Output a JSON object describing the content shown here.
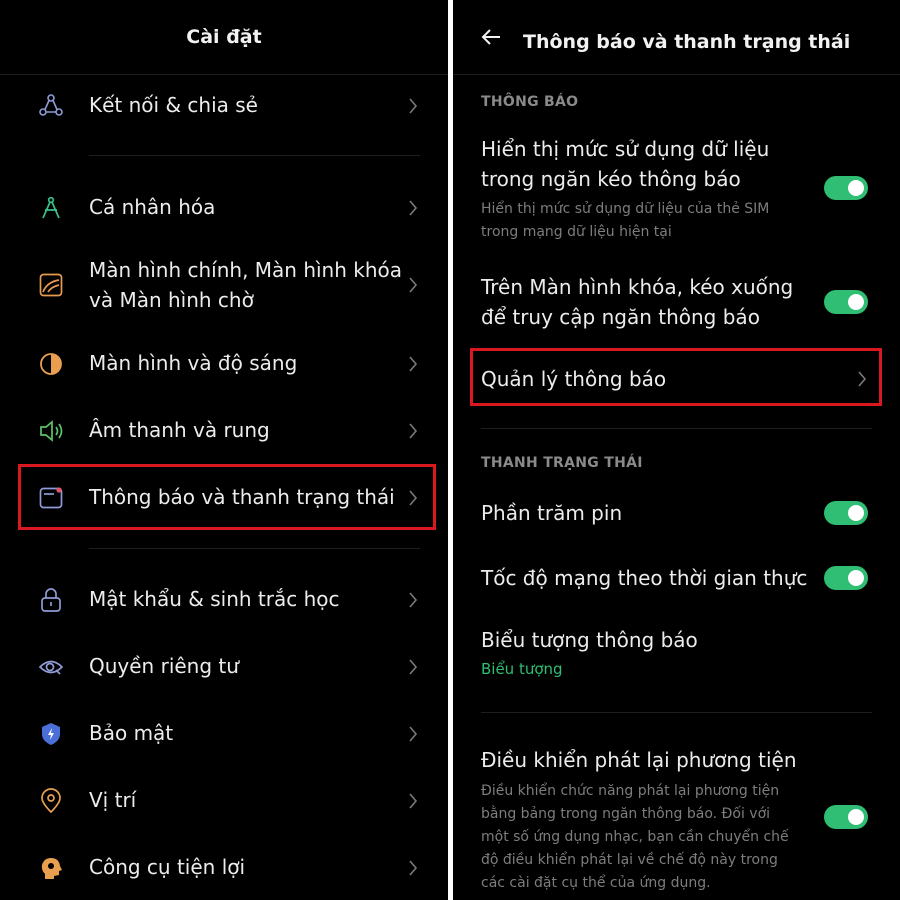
{
  "left": {
    "title": "Cài đặt",
    "items": [
      {
        "label": "Kết nối & chia sẻ",
        "icon": "share-nodes-icon"
      },
      {
        "label": "Cá nhân hóa",
        "icon": "compass-icon"
      },
      {
        "label": "Màn hình chính, Màn hình khóa",
        "label2": "và Màn hình chờ",
        "icon": "wallpaper-icon"
      },
      {
        "label": "Màn hình và độ sáng",
        "icon": "brightness-icon"
      },
      {
        "label": "Âm thanh và rung",
        "icon": "speaker-icon"
      },
      {
        "label": "Thông báo và thanh trạng thái",
        "icon": "notification-icon"
      },
      {
        "label": "Mật khẩu & sinh trắc học",
        "icon": "lock-icon"
      },
      {
        "label": "Quyền riêng tư",
        "icon": "eye-icon"
      },
      {
        "label": "Bảo mật",
        "icon": "shield-icon"
      },
      {
        "label": "Vị trí",
        "icon": "location-pin-icon"
      },
      {
        "label": "Công cụ tiện lợi",
        "icon": "tools-icon"
      }
    ]
  },
  "right": {
    "title": "Thông báo và thanh trạng thái",
    "section1": "THÔNG BÁO",
    "data_usage": {
      "line1": "Hiển thị mức sử dụng dữ liệu",
      "line2": "trong ngăn kéo thông báo",
      "sub1": "Hiển thị mức sử dụng dữ liệu của thẻ SIM",
      "sub2": "trong mạng dữ liệu hiện tại",
      "enabled": true
    },
    "lockscreen": {
      "line1": "Trên Màn hình khóa, kéo xuống",
      "line2": "để truy cập ngăn thông báo",
      "enabled": true
    },
    "manage": "Quản lý thông báo",
    "section2": "THANH TRẠNG THÁI",
    "battery": {
      "label": "Phần trăm pin",
      "enabled": true
    },
    "network_speed": {
      "label": "Tốc độ mạng theo thời gian thực",
      "enabled": true
    },
    "notif_icons": {
      "label": "Biểu tượng thông báo",
      "value": "Biểu tượng"
    },
    "media": {
      "label": "Điều khiển phát lại phương tiện",
      "sub1": "Điều khiển chức năng phát lại phương tiện",
      "sub2": "bằng bảng trong ngăn thông báo. Đối với",
      "sub3": "một số ứng dụng nhạc, bạn cần chuyển chế",
      "sub4": "độ điều khiển phát lại về chế độ này trong",
      "sub5": "các cài đặt cụ thể của ứng dụng.",
      "enabled": true
    }
  },
  "colors": {
    "accent_green": "#2fbe74",
    "highlight_red": "#d9191f",
    "background": "#000000"
  }
}
